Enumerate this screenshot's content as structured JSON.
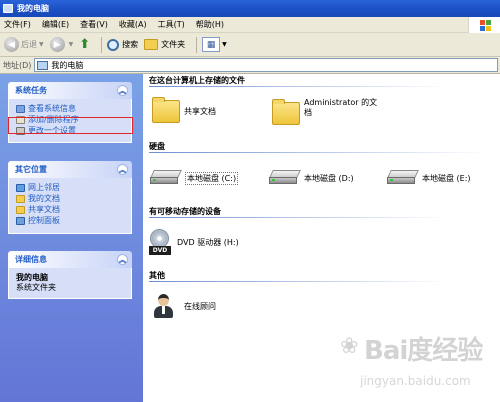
{
  "window": {
    "title": "我的电脑"
  },
  "menu": [
    "文件(F)",
    "编辑(E)",
    "查看(V)",
    "收藏(A)",
    "工具(T)",
    "帮助(H)"
  ],
  "toolbar": {
    "back": "后退",
    "search": "搜索",
    "folders": "文件夹"
  },
  "address": {
    "label": "地址(D)",
    "value": "我的电脑"
  },
  "sidebar": {
    "system_tasks": {
      "title": "系统任务",
      "links": [
        "查看系统信息",
        "添加/删除程序",
        "更改一个设置"
      ]
    },
    "other_places": {
      "title": "其它位置",
      "links": [
        "网上邻居",
        "我的文档",
        "共享文档",
        "控制面板"
      ]
    },
    "details": {
      "title": "详细信息",
      "name": "我的电脑",
      "desc": "系统文件夹"
    }
  },
  "content": {
    "files_section": "在这台计算机上存储的文件",
    "shared_docs": "共享文档",
    "admin_docs_line1": "Administrator 的文",
    "admin_docs_line2": "档",
    "harddisk_section": "硬盘",
    "drives": [
      "本地磁盘 (C:)",
      "本地磁盘 (D:)",
      "本地磁盘 (E:)"
    ],
    "removable_section": "有可移动存储的设备",
    "dvd": "DVD 驱动器 (H:)",
    "dvd_badge": "DVD",
    "other_section": "其他",
    "advisor": "在线顾问"
  },
  "watermark": {
    "brand": "Bai度经验",
    "url": "jingyan.baidu.com"
  }
}
